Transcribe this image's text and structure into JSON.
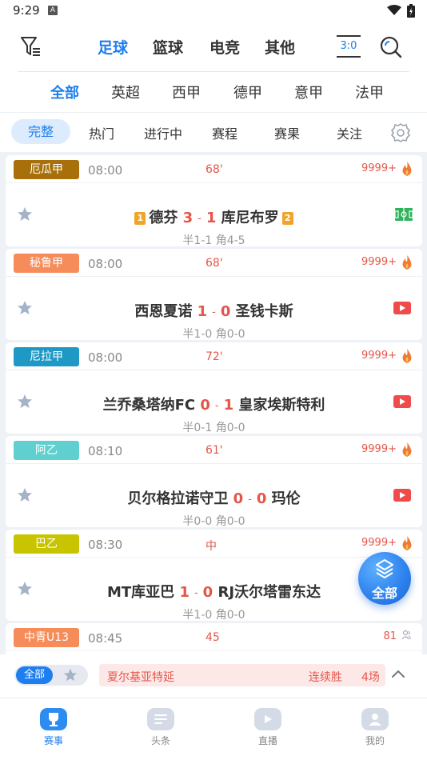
{
  "status_bar": {
    "time": "9:29",
    "notification_letter": "A"
  },
  "top_nav": {
    "sport_tabs": [
      "足球",
      "篮球",
      "电竞",
      "其他"
    ],
    "active_sport": "足球",
    "score_icon_text": "3:0"
  },
  "league_tabs": [
    "全部",
    "英超",
    "西甲",
    "德甲",
    "意甲",
    "法甲"
  ],
  "filter_tabs": [
    "完整",
    "热门",
    "进行中",
    "赛程",
    "赛果",
    "关注"
  ],
  "matches": [
    {
      "league": "厄瓜甲",
      "league_color": "#a8700a",
      "time": "08:00",
      "minute": "68'",
      "heat": "9999+",
      "home_rank": "1",
      "home": "德芬",
      "home_score": "3",
      "away_score": "1",
      "away": "库尼布罗",
      "away_rank": "2",
      "halftime": "半1-1 角4-5",
      "media": "field"
    },
    {
      "league": "秘鲁甲",
      "league_color": "#f58c5a",
      "time": "08:00",
      "minute": "68'",
      "heat": "9999+",
      "home": "西恩夏诺",
      "home_score": "1",
      "away_score": "0",
      "away": "圣钱卡斯",
      "halftime": "半1-0 角0-0",
      "media": "video"
    },
    {
      "league": "尼拉甲",
      "league_color": "#1e98c4",
      "time": "08:00",
      "minute": "72'",
      "heat": "9999+",
      "home": "兰乔桑塔纳FC",
      "home_score": "0",
      "away_score": "1",
      "away": "皇家埃斯特利",
      "halftime": "半0-1 角0-0",
      "media": "video"
    },
    {
      "league": "阿乙",
      "league_color": "#5fcfcf",
      "time": "08:10",
      "minute": "61'",
      "heat": "9999+",
      "home": "贝尔格拉诺守卫",
      "home_score": "0",
      "away_score": "0",
      "away": "玛伦",
      "halftime": "半0-0 角0-0",
      "media": "video"
    },
    {
      "league": "巴乙",
      "league_color": "#c9c400",
      "time": "08:30",
      "minute": "中",
      "heat": "9999+",
      "home": "MT库亚巴",
      "home_score": "1",
      "away_score": "0",
      "away": "RJ沃尔塔雷东达",
      "halftime": "半1-0 角0-0",
      "media": "none"
    },
    {
      "league": "中青U13",
      "league_color": "#f58c5a",
      "time": "08:45",
      "minute": "45",
      "heat": "81",
      "home": "",
      "home_score": "",
      "away_score": "",
      "away": "",
      "halftime": "",
      "media": "none"
    }
  ],
  "float_button": {
    "label": "全部"
  },
  "bottom_filter": {
    "all_label": "全部",
    "streak_team": "夏尔基亚特延",
    "streak_label": "连续胜",
    "streak_count": "4场"
  },
  "tab_bar": [
    {
      "label": "赛事",
      "active": true
    },
    {
      "label": "头条",
      "active": false
    },
    {
      "label": "直播",
      "active": false
    },
    {
      "label": "我的",
      "active": false
    }
  ],
  "colors": {
    "accent": "#1e7ef0",
    "live_red": "#e5564a",
    "rank_orange": "#f0a52a"
  }
}
